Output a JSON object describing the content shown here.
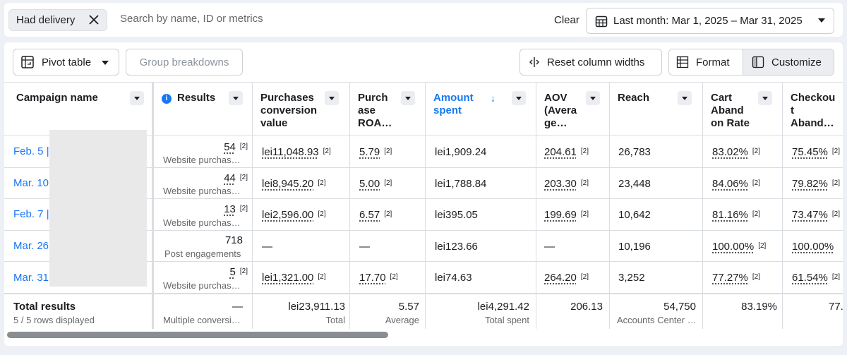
{
  "filter": {
    "chip_label": "Had delivery",
    "search_placeholder": "Search by name, ID or metrics",
    "clear_label": "Clear",
    "date_range": "Last month: Mar 1, 2025 – Mar 31, 2025"
  },
  "toolbar": {
    "pivot_label": "Pivot table",
    "group_label": "Group breakdowns",
    "reset_label": "Reset column widths",
    "format_label": "Format",
    "customize_label": "Customize"
  },
  "columns": {
    "campaign": "Campaign name",
    "results": "Results",
    "pcv": [
      "Purchases",
      "conversion",
      "value"
    ],
    "roas": [
      "Purch",
      "ase",
      "ROA…"
    ],
    "amount": [
      "Amount",
      "spent"
    ],
    "aov": [
      "AOV",
      "(Avera",
      "ge…"
    ],
    "reach": "Reach",
    "cart": [
      "Cart",
      "Aband",
      "on Rate"
    ],
    "checkout": [
      "Checkou",
      "t",
      "Aband…"
    ]
  },
  "rows": [
    {
      "campaign": "Feb. 5 |",
      "results": "54",
      "results_sub": "Website purchas…",
      "pcv": "lei11,048.93",
      "roas": "5.79",
      "amount": "lei1,909.24",
      "aov": "204.61",
      "reach": "26,783",
      "cart": "83.02%",
      "checkout": "75.45%"
    },
    {
      "campaign": "Mar. 10",
      "results": "44",
      "results_sub": "Website purchas…",
      "pcv": "lei8,945.20",
      "roas": "5.00",
      "amount": "lei1,788.84",
      "aov": "203.30",
      "reach": "23,448",
      "cart": "84.06%",
      "checkout": "79.82%"
    },
    {
      "campaign": "Feb. 7 |",
      "results": "13",
      "results_sub": "Website purchas…",
      "pcv": "lei2,596.00",
      "roas": "6.57",
      "amount": "lei395.05",
      "aov": "199.69",
      "reach": "10,642",
      "cart": "81.16%",
      "checkout": "73.47%"
    },
    {
      "campaign": "Mar. 26",
      "results": "718",
      "results_sub": "Post engagements",
      "pcv": "—",
      "roas": "—",
      "amount": "lei123.66",
      "aov": "—",
      "reach": "10,196",
      "cart": "100.00%",
      "checkout": "100.00%"
    },
    {
      "campaign": "Mar. 31",
      "results": "5",
      "results_sub": "Website purchas…",
      "pcv": "lei1,321.00",
      "roas": "17.70",
      "amount": "lei74.63",
      "aov": "264.20",
      "reach": "3,252",
      "cart": "77.27%",
      "checkout": "61.54%"
    }
  ],
  "ref_mark": "[2]",
  "totals": {
    "label": "Total results",
    "sub": "5 / 5 rows displayed",
    "results": "—",
    "results_sub": "Multiple conversi…",
    "pcv": "lei23,911.13",
    "pcv_sub": "Total",
    "roas": "5.57",
    "roas_sub": "Average",
    "amount": "lei4,291.42",
    "amount_sub": "Total spent",
    "aov": "206.13",
    "reach": "54,750",
    "reach_sub": "Accounts Center …",
    "cart": "83.19%",
    "checkout": "77."
  },
  "colors": {
    "accent": "#1877f2",
    "border": "#dadde1",
    "muted": "#65676b"
  }
}
